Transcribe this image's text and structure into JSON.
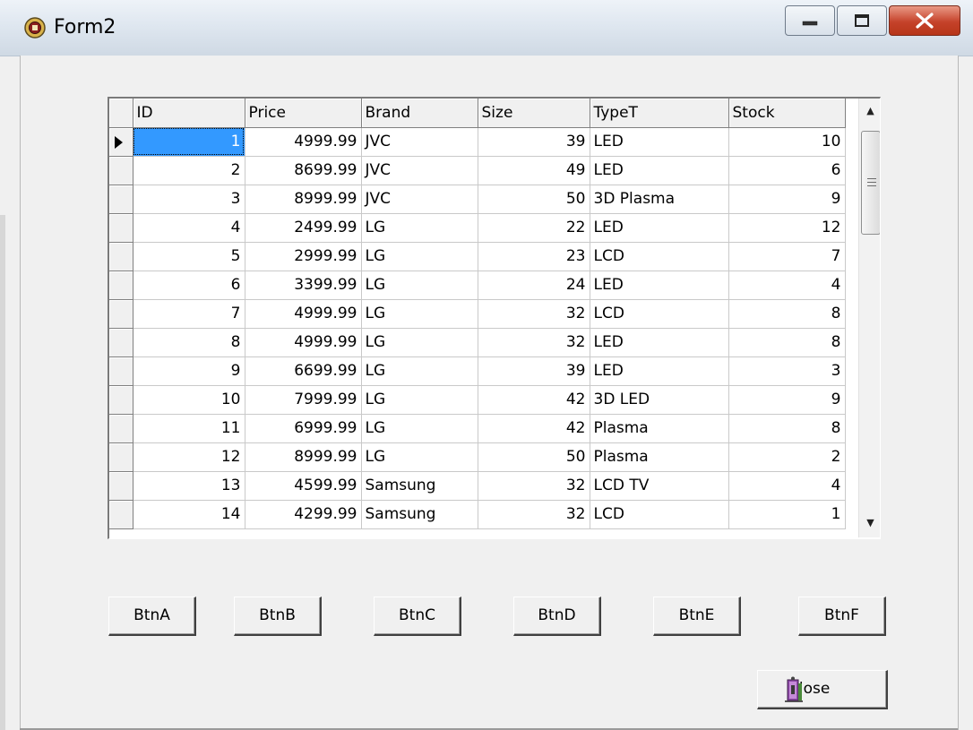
{
  "window": {
    "title": "Form2"
  },
  "grid": {
    "columns": [
      "ID",
      "Price",
      "Brand",
      "Size",
      "TypeT",
      "Stock"
    ],
    "rows": [
      {
        "id": "1",
        "price": "4999.99",
        "brand": "JVC",
        "size": "39",
        "type": "LED",
        "stock": "10"
      },
      {
        "id": "2",
        "price": "8699.99",
        "brand": "JVC",
        "size": "49",
        "type": "LED",
        "stock": "6"
      },
      {
        "id": "3",
        "price": "8999.99",
        "brand": "JVC",
        "size": "50",
        "type": "3D Plasma",
        "stock": "9"
      },
      {
        "id": "4",
        "price": "2499.99",
        "brand": "LG",
        "size": "22",
        "type": "LED",
        "stock": "12"
      },
      {
        "id": "5",
        "price": "2999.99",
        "brand": "LG",
        "size": "23",
        "type": "LCD",
        "stock": "7"
      },
      {
        "id": "6",
        "price": "3399.99",
        "brand": "LG",
        "size": "24",
        "type": "LED",
        "stock": "4"
      },
      {
        "id": "7",
        "price": "4999.99",
        "brand": "LG",
        "size": "32",
        "type": "LCD",
        "stock": "8"
      },
      {
        "id": "8",
        "price": "4999.99",
        "brand": "LG",
        "size": "32",
        "type": "LED",
        "stock": "8"
      },
      {
        "id": "9",
        "price": "6699.99",
        "brand": "LG",
        "size": "39",
        "type": "LED",
        "stock": "3"
      },
      {
        "id": "10",
        "price": "7999.99",
        "brand": "LG",
        "size": "42",
        "type": "3D LED",
        "stock": "9"
      },
      {
        "id": "11",
        "price": "6999.99",
        "brand": "LG",
        "size": "42",
        "type": "Plasma",
        "stock": "8"
      },
      {
        "id": "12",
        "price": "8999.99",
        "brand": "LG",
        "size": "50",
        "type": "Plasma",
        "stock": "2"
      },
      {
        "id": "13",
        "price": "4599.99",
        "brand": "Samsung",
        "size": "32",
        "type": "LCD TV",
        "stock": "4"
      },
      {
        "id": "14",
        "price": "4299.99",
        "brand": "Samsung",
        "size": "32",
        "type": "LCD",
        "stock": "1"
      }
    ]
  },
  "buttons": {
    "btnA": "BtnA",
    "btnB": "BtnB",
    "btnC": "BtnC",
    "btnD": "BtnD",
    "btnE": "BtnE",
    "btnF": "BtnF",
    "close_mnemonic": "C",
    "close_rest": "lose"
  },
  "icons": {
    "app": "form-app-icon",
    "close_button_icon": "exit-door-icon"
  }
}
